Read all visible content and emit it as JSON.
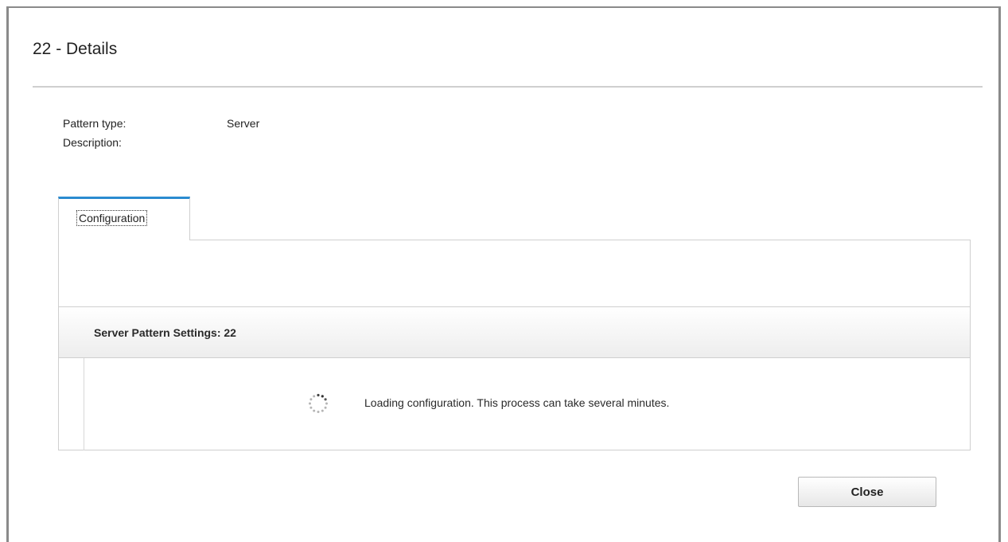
{
  "dialog": {
    "title": "22 - Details"
  },
  "properties": [
    {
      "label": "Pattern type:",
      "value": "Server"
    },
    {
      "label": "Description:",
      "value": ""
    }
  ],
  "tabs": [
    {
      "label": "Configuration",
      "active": true
    }
  ],
  "section": {
    "title": "Server Pattern Settings: 22",
    "loading_text": "Loading configuration. This process can take several minutes."
  },
  "footer": {
    "close_label": "Close"
  },
  "colors": {
    "tab_accent": "#2a8bd0",
    "border": "#cfcfcf"
  },
  "icons": {
    "spinner": "loading-spinner-icon"
  }
}
